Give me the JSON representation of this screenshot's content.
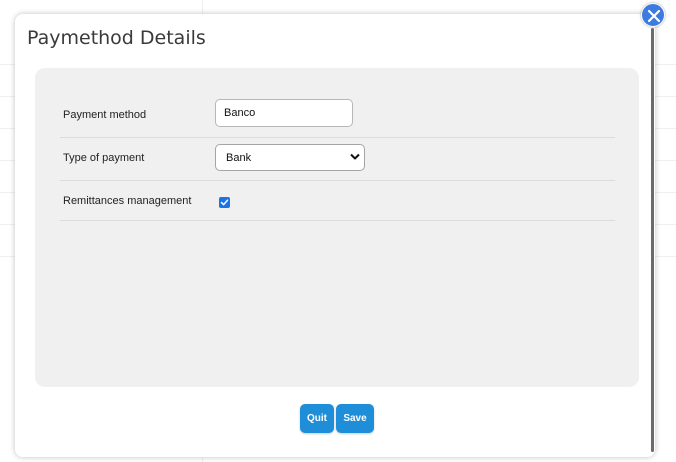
{
  "dialog": {
    "title": "Paymethod Details"
  },
  "form": {
    "payment_method": {
      "label": "Payment method",
      "value": "Banco"
    },
    "type_of_payment": {
      "label": "Type of payment",
      "selected": "Bank"
    },
    "remittances_management": {
      "label": "Remittances management",
      "checked": true
    }
  },
  "buttons": {
    "quit_label": "Quit",
    "save_label": "Save"
  },
  "colors": {
    "accent": "#1e8ed8",
    "close": "#3d7be0",
    "checkbox": "#1a73e8",
    "panel": "#f0f0f0"
  },
  "icons": {
    "close": "close-icon",
    "dropdown": "chevron-down-icon",
    "check": "checkmark-icon"
  }
}
